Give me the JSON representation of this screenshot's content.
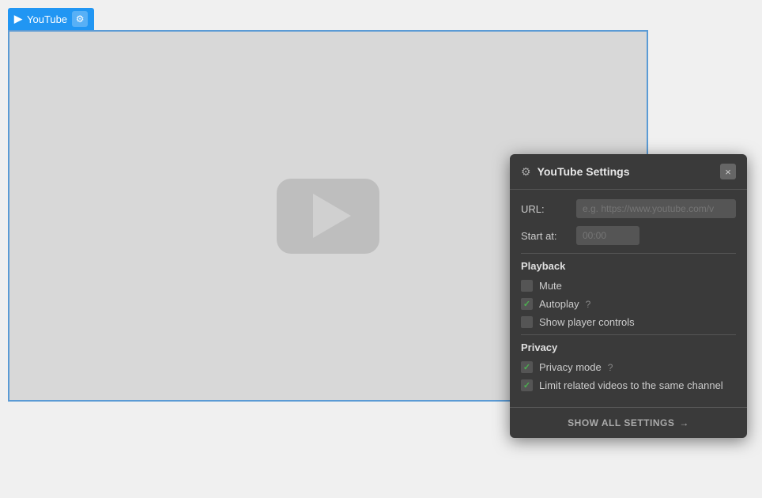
{
  "widget": {
    "titlebar": {
      "icon": "▶",
      "label": "YouTube",
      "gear_symbol": "⚙"
    },
    "video": {
      "placeholder_text": ""
    }
  },
  "settings": {
    "title": "YouTube Settings",
    "gear_symbol": "⚙",
    "close_label": "×",
    "url_label": "URL:",
    "url_placeholder": "e.g. https://www.youtube.com/v",
    "start_label": "Start at:",
    "start_placeholder": "00:00",
    "sections": {
      "playback": {
        "title": "Playback",
        "items": [
          {
            "id": "mute",
            "label": "Mute",
            "checked": false
          },
          {
            "id": "autoplay",
            "label": "Autoplay",
            "checked": true,
            "has_help": true
          },
          {
            "id": "show_controls",
            "label": "Show player controls",
            "checked": false
          }
        ]
      },
      "privacy": {
        "title": "Privacy",
        "items": [
          {
            "id": "privacy_mode",
            "label": "Privacy mode",
            "checked": true,
            "has_help": true
          },
          {
            "id": "limit_related",
            "label": "Limit related videos to the same channel",
            "checked": true
          }
        ]
      }
    },
    "show_all_label": "SHOW ALL SETTINGS",
    "show_all_arrow": "→"
  }
}
